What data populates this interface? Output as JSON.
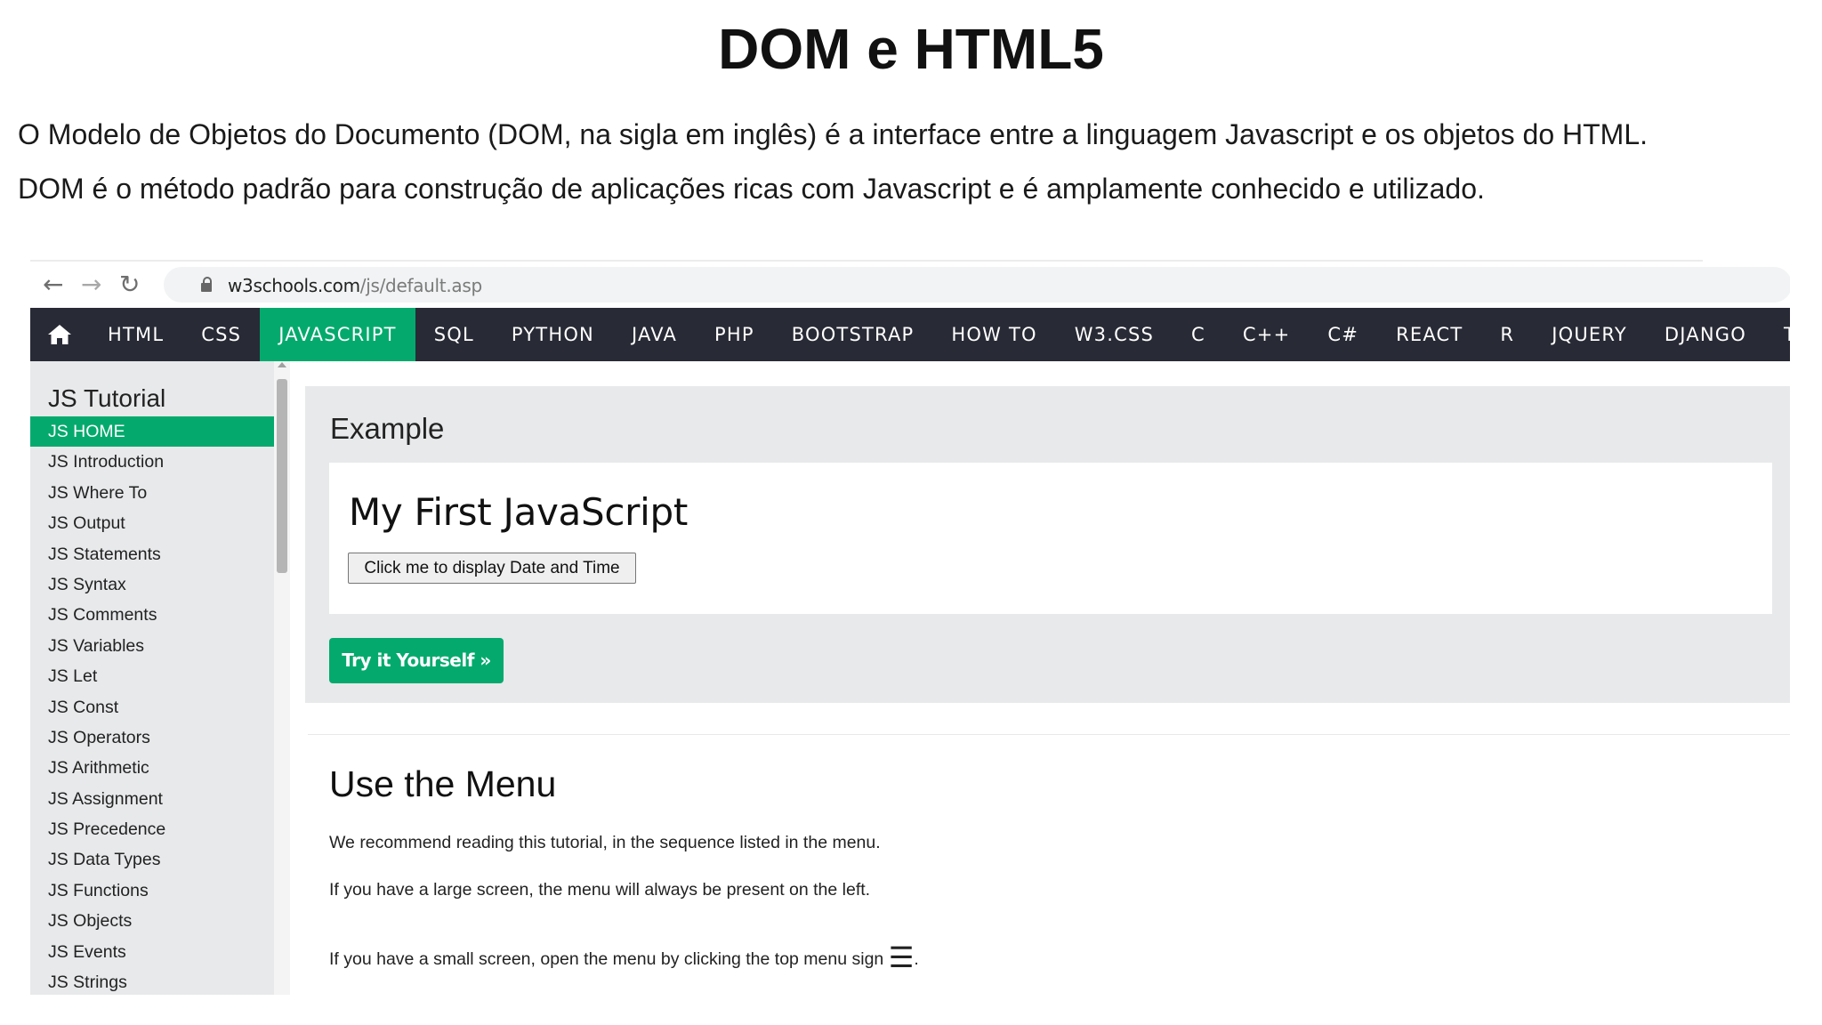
{
  "slide": {
    "title": "DOM e HTML5",
    "paragraph_1": "O Modelo de Objetos do Documento (DOM, na sigla em inglês) é a interface entre a linguagem Javascript e os objetos do HTML.",
    "paragraph_2": "DOM é o método padrão para construção de aplicações ricas com Javascript e é amplamente conhecido e utilizado."
  },
  "browser": {
    "url_domain": "w3schools.com",
    "url_path": "/js/default.asp",
    "icons": [
      "back-arrow-icon",
      "forward-arrow-icon",
      "reload-icon",
      "lock-icon"
    ]
  },
  "topnav": {
    "home_icon": "home-icon",
    "items": [
      "HTML",
      "CSS",
      "JAVASCRIPT",
      "SQL",
      "PYTHON",
      "JAVA",
      "PHP",
      "BOOTSTRAP",
      "HOW TO",
      "W3.CSS",
      "C",
      "C++",
      "C#",
      "REACT",
      "R",
      "JQUERY",
      "DJANGO",
      "TYPESC"
    ],
    "active": "JAVASCRIPT"
  },
  "sidebar": {
    "title": "JS Tutorial",
    "items": [
      "JS HOME",
      "JS Introduction",
      "JS Where To",
      "JS Output",
      "JS Statements",
      "JS Syntax",
      "JS Comments",
      "JS Variables",
      "JS Let",
      "JS Const",
      "JS Operators",
      "JS Arithmetic",
      "JS Assignment",
      "JS Precedence",
      "JS Data Types",
      "JS Functions",
      "JS Objects",
      "JS Events",
      "JS Strings"
    ],
    "active": "JS HOME"
  },
  "example": {
    "heading": "Example",
    "demo_title": "My First JavaScript",
    "demo_button": "Click me to display Date and Time",
    "try_button": "Try it Yourself »"
  },
  "menu_section": {
    "title": "Use the Menu",
    "p1": "We recommend reading this tutorial, in the sequence listed in the menu.",
    "p2": "If you have a large screen, the menu will always be present on the left.",
    "p3": "If you have a small screen, open the menu by clicking the top menu sign",
    "p3_icon": "☰",
    "p3_end": "."
  },
  "colors": {
    "accent_green": "#04aa6d",
    "nav_bg": "#282a35",
    "panel_gray": "#e7e9eb"
  }
}
